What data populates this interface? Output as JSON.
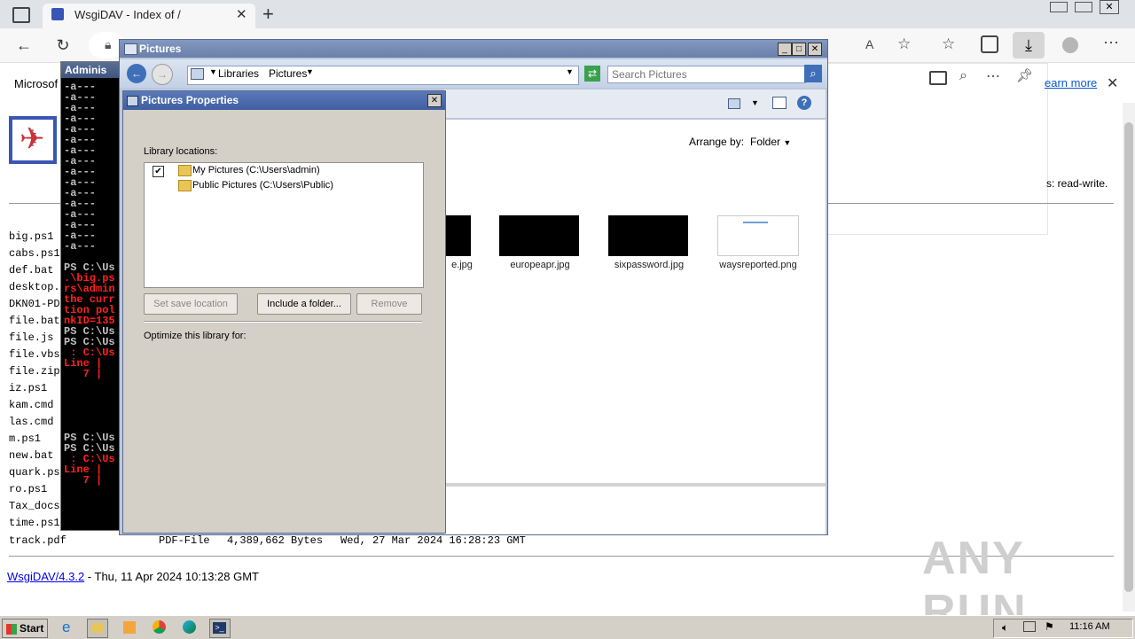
{
  "browser": {
    "tab_title": "WsgiDAV - Index of /",
    "learn_more": "earn more",
    "page_banner_left": "Microsof"
  },
  "page": {
    "right_text": "s: read-write.",
    "files": [
      "big.ps1",
      "cabs.ps1",
      "def.bat",
      "desktop.",
      "DKN01-PD",
      "file.bat",
      "file.js",
      "file.vbs",
      "file.zip",
      "iz.ps1",
      "kam.cmd",
      "las.cmd",
      "m.ps1",
      "new.bat",
      "quark.ps",
      "ro.ps1",
      "Tax_docs",
      "time.ps1"
    ],
    "last_row": {
      "name": "track.pdf",
      "type": "PDF-File",
      "size": "4,389,662 Bytes",
      "date": "Wed, 27 Mar 2024 16:28:23 GMT"
    },
    "footer_link": "WsgiDAV/4.3.2",
    "footer_text": " - Thu, 11 Apr 2024 10:13:28 GMT"
  },
  "console": {
    "title": "Adminis",
    "lines_white": [
      "-a---",
      "-a---",
      "-a---",
      "-a---",
      "-a---",
      "-a---",
      "-a---",
      "-a---",
      "-a---",
      "-a---",
      "-a---",
      "-a---",
      "-a---",
      "-a---",
      "-a---",
      "-a---"
    ],
    "ps1": "PS C:\\Us",
    "err1": [
      ".\\big.ps",
      "rs\\admin",
      "the curr",
      "tion pol",
      "nkID=135"
    ],
    "ps2": "PS C:\\Us",
    "ps3": "PS C:\\Us",
    "err2": [
      " : C:\\Us",
      "Line |",
      "   7 |"
    ],
    "ps4": "PS C:\\Us",
    "ps5": "PS C:\\Us",
    "err3": [
      " : C:\\Us",
      "Line |",
      "   7 |"
    ],
    "ps6": "PS C:\\Us"
  },
  "explorer": {
    "title": "Pictures",
    "breadcrumb": [
      "Libraries",
      "Pictures"
    ],
    "search_placeholder": "Search Pictures",
    "arrange_label": "Arrange by:",
    "arrange_value": "Folder",
    "files": [
      {
        "name": "e.jpg"
      },
      {
        "name": "europeapr.jpg"
      },
      {
        "name": "sixpassword.jpg"
      },
      {
        "name": "waysreported.png"
      }
    ]
  },
  "properties": {
    "title": "Pictures Properties",
    "locations_label": "Library locations:",
    "locations": [
      "My Pictures (C:\\Users\\admin)",
      "Public Pictures (C:\\Users\\Public)"
    ],
    "btn_set_save": "Set save location",
    "btn_include": "Include a folder...",
    "btn_remove": "Remove",
    "optimize_label": "Optimize this library for:"
  },
  "taskbar": {
    "start": "Start",
    "clock": "11:16 AM"
  },
  "watermark": "ANY RUN"
}
